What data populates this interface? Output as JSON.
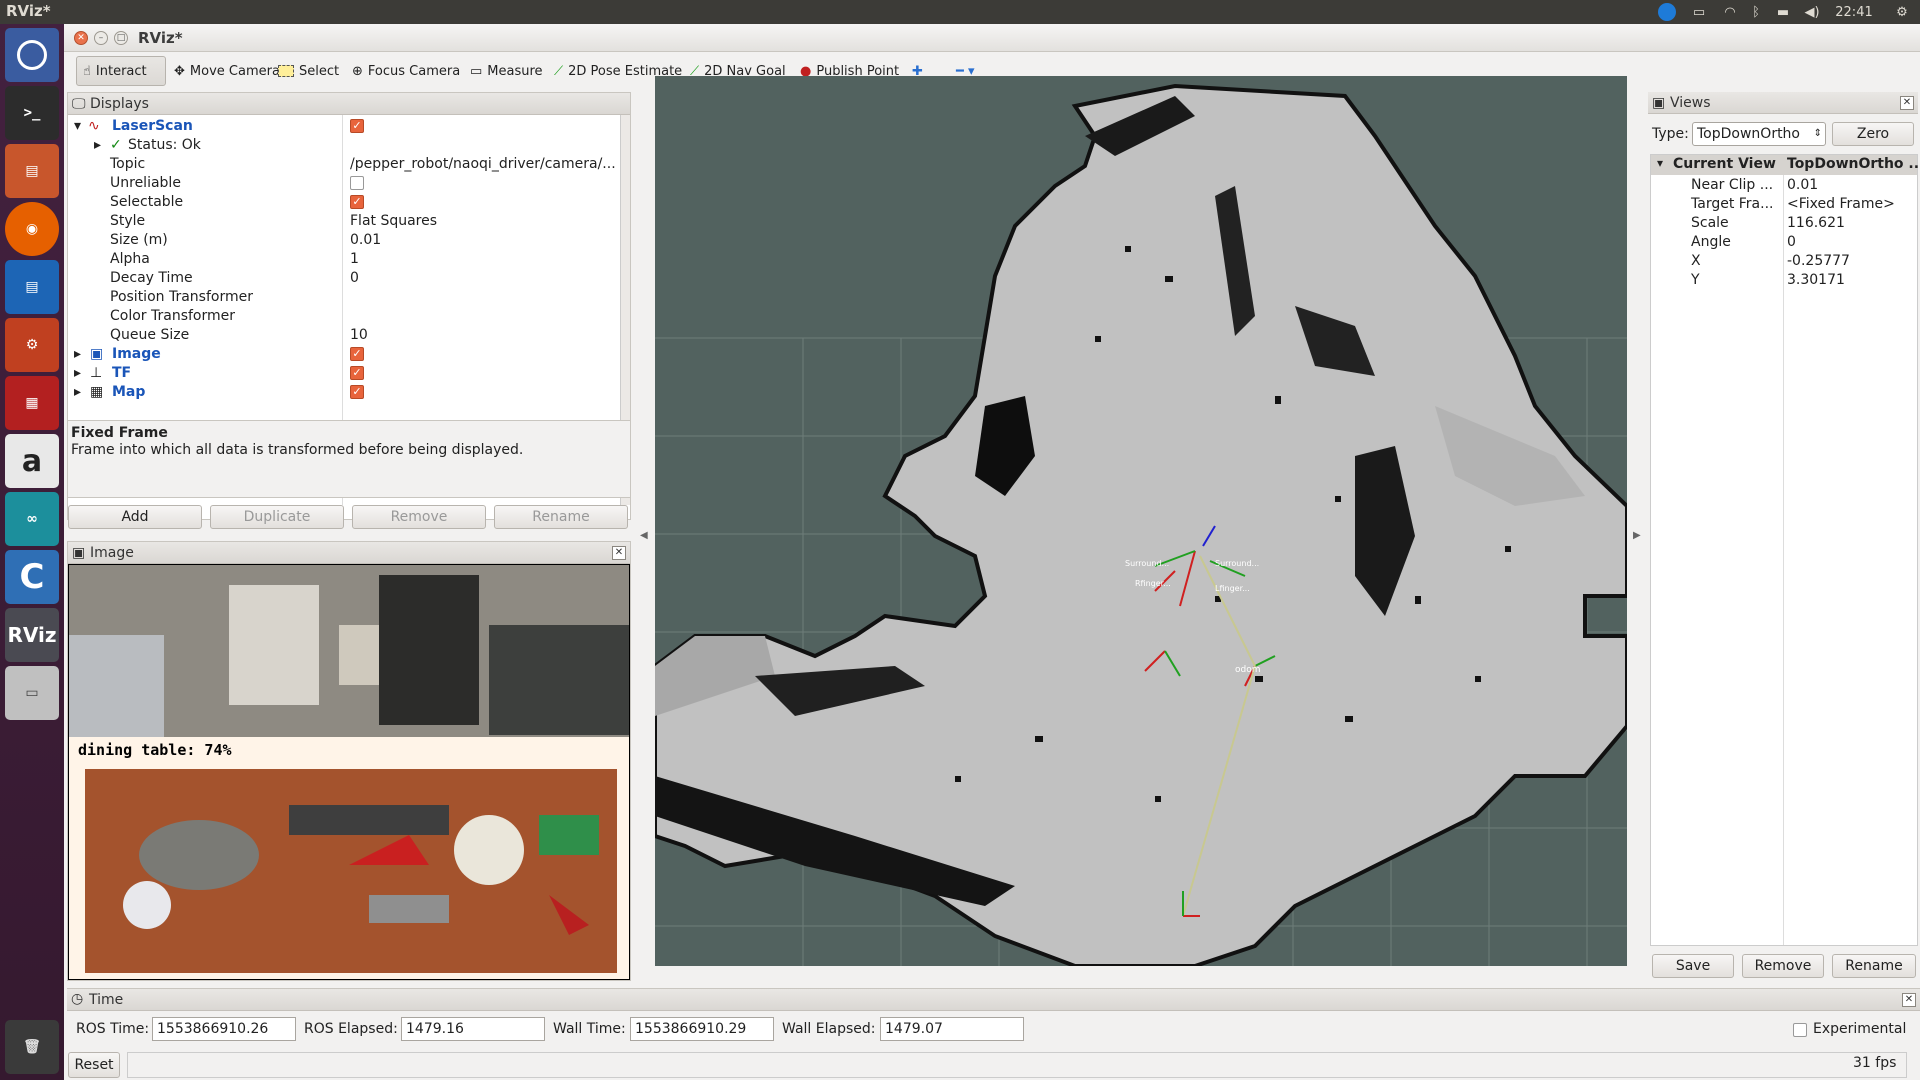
{
  "system": {
    "top_title": "RViz*",
    "clock": "22:41"
  },
  "window": {
    "title": "RViz*"
  },
  "toolbar": {
    "tools": [
      {
        "label": "Interact",
        "icon": "hand-icon"
      },
      {
        "label": "Move Camera",
        "icon": "move-camera-icon"
      },
      {
        "label": "Select",
        "icon": "select-icon"
      },
      {
        "label": "Focus Camera",
        "icon": "focus-camera-icon"
      },
      {
        "label": "Measure",
        "icon": "measure-icon"
      },
      {
        "label": "2D Pose Estimate",
        "icon": "pose-estimate-icon"
      },
      {
        "label": "2D Nav Goal",
        "icon": "nav-goal-icon"
      },
      {
        "label": "Publish Point",
        "icon": "publish-point-icon"
      }
    ]
  },
  "displays": {
    "title": "Displays",
    "laserscan": {
      "name": "LaserScan",
      "status": "Status: Ok",
      "props": [
        {
          "label": "Topic",
          "value": "/pepper_robot/naoqi_driver/camera/..."
        },
        {
          "label": "Unreliable",
          "value": ""
        },
        {
          "label": "Selectable",
          "value": ""
        },
        {
          "label": "Style",
          "value": "Flat Squares"
        },
        {
          "label": "Size (m)",
          "value": "0.01"
        },
        {
          "label": "Alpha",
          "value": "1"
        },
        {
          "label": "Decay Time",
          "value": "0"
        },
        {
          "label": "Position Transformer",
          "value": ""
        },
        {
          "label": "Color Transformer",
          "value": ""
        },
        {
          "label": "Queue Size",
          "value": "10"
        }
      ]
    },
    "others": [
      {
        "name": "Image"
      },
      {
        "name": "TF"
      },
      {
        "name": "Map"
      }
    ],
    "help_title": "Fixed Frame",
    "help_text": "Frame into which all data is transformed before being displayed.",
    "buttons": {
      "add": "Add",
      "duplicate": "Duplicate",
      "remove": "Remove",
      "rename": "Rename"
    }
  },
  "image_panel": {
    "title": "Image",
    "detection_label": "dining table: 74%"
  },
  "views": {
    "title": "Views",
    "type_label": "Type:",
    "type_value": "TopDownOrtho",
    "zero": "Zero",
    "header_key": "Current View",
    "header_value": "TopDownOrtho ...",
    "props": [
      {
        "label": "Near Clip ...",
        "value": "0.01"
      },
      {
        "label": "Target Fra...",
        "value": "<Fixed Frame>"
      },
      {
        "label": "Scale",
        "value": "116.621"
      },
      {
        "label": "Angle",
        "value": "0"
      },
      {
        "label": "X",
        "value": "-0.25777"
      },
      {
        "label": "Y",
        "value": "3.30171"
      }
    ],
    "buttons": {
      "save": "Save",
      "remove": "Remove",
      "rename": "Rename"
    }
  },
  "time": {
    "title": "Time",
    "ros_time_label": "ROS Time:",
    "ros_time": "1553866910.26",
    "ros_elapsed_label": "ROS Elapsed:",
    "ros_elapsed": "1479.16",
    "wall_time_label": "Wall Time:",
    "wall_time": "1553866910.29",
    "wall_elapsed_label": "Wall Elapsed:",
    "wall_elapsed": "1479.07",
    "experimental": "Experimental",
    "reset": "Reset",
    "fps": "31 fps"
  },
  "viewport": {
    "frame_label": "odom"
  }
}
